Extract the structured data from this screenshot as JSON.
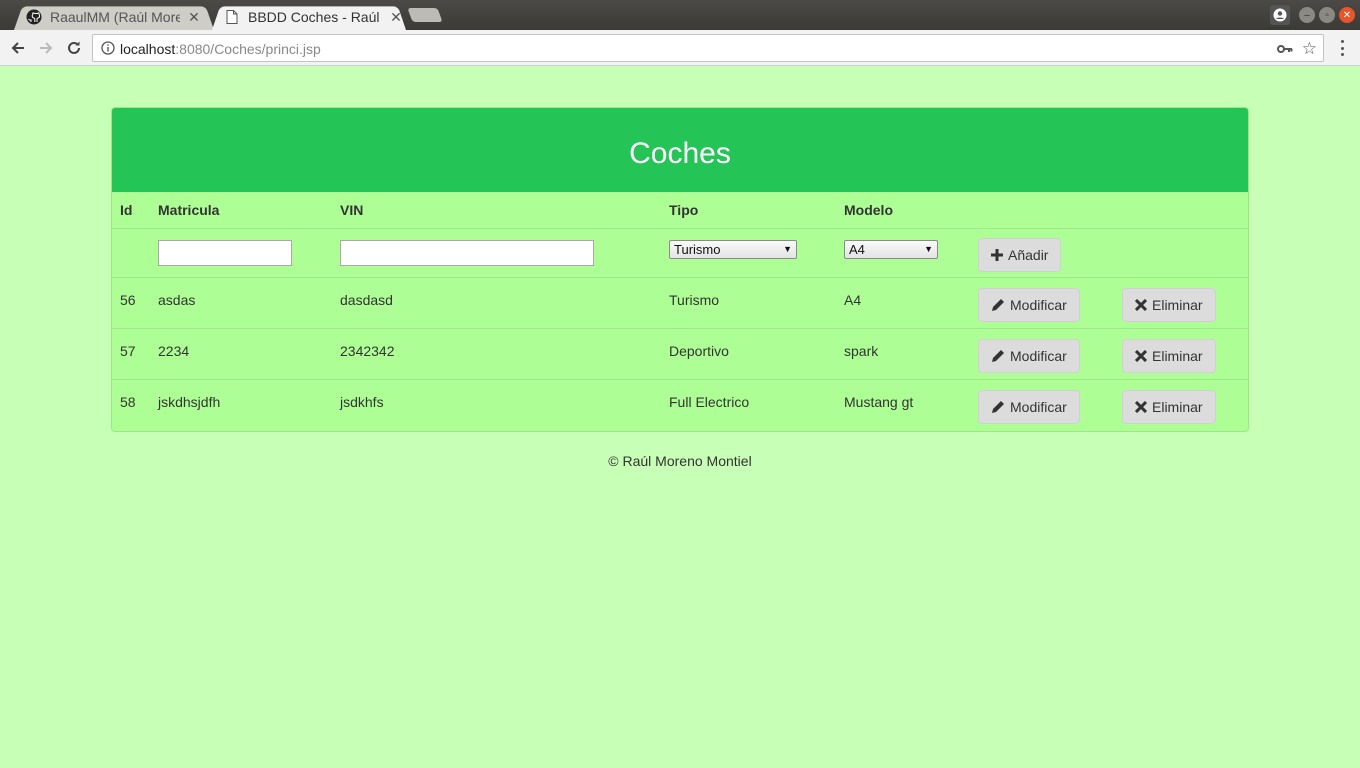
{
  "browser": {
    "tabs": [
      {
        "title": "RaaulMM (Raúl Moreno Montiel)",
        "icon": "github-icon",
        "active": false
      },
      {
        "title": "BBDD Coches - Raúl Moreno Montiel",
        "icon": "page-icon",
        "active": true
      }
    ],
    "url_host": "localhost",
    "url_rest": ":8080/Coches/princi.jsp"
  },
  "panel": {
    "title": "Coches"
  },
  "table": {
    "headers": {
      "id": "Id",
      "matricula": "Matricula",
      "vin": "VIN",
      "tipo": "Tipo",
      "modelo": "Modelo"
    },
    "form": {
      "matricula_value": "",
      "vin_value": "",
      "tipo_selected": "Turismo",
      "modelo_selected": "A4",
      "add_label": "Añadir"
    },
    "rows": [
      {
        "id": "56",
        "matricula": "asdas",
        "vin": "dasdasd",
        "tipo": "Turismo",
        "modelo": "A4"
      },
      {
        "id": "57",
        "matricula": "2234",
        "vin": "2342342",
        "tipo": "Deportivo",
        "modelo": "spark"
      },
      {
        "id": "58",
        "matricula": "jskdhsjdfh",
        "vin": "jsdkhfs",
        "tipo": "Full Electrico",
        "modelo": "Mustang gt"
      }
    ],
    "modify_label": "Modificar",
    "delete_label": "Eliminar"
  },
  "footer": {
    "text": "© Raúl Moreno Montiel"
  },
  "colors": {
    "page_bg": "#c8ffb6",
    "panel_bg": "#adff95",
    "heading_bg": "#25c457"
  }
}
